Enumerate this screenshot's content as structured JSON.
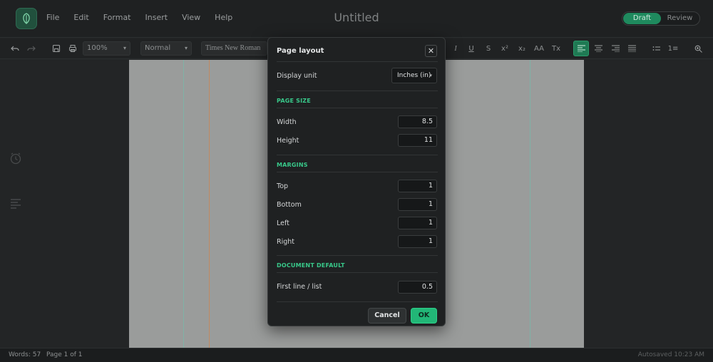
{
  "app": {
    "title": "Untitled",
    "menu": [
      "File",
      "Edit",
      "Format",
      "Insert",
      "View",
      "Help"
    ],
    "mode": {
      "options": [
        "Draft",
        "Review"
      ],
      "active": "Draft"
    }
  },
  "toolbar": {
    "zoom": "100%",
    "style": "Normal",
    "font": "Times New Roman",
    "text_buttons": {
      "italic": "I",
      "underline": "U",
      "strikethrough": "S",
      "superscript": "x²",
      "subscript": "x₂",
      "change_case": "AA",
      "clear_format": "Tx",
      "numbered_list": "1≡"
    },
    "active_align": "align-left",
    "accent_color": "#1f7a54"
  },
  "dialog": {
    "title": "Page layout",
    "close_glyph": "✕",
    "display_unit_label": "Display unit",
    "display_unit_value": "Inches (in)",
    "sections": {
      "page_size": "PAGE SIZE",
      "margins": "MARGINS",
      "document_default": "DOCUMENT DEFAULT"
    },
    "fields": {
      "width": {
        "label": "Width",
        "value": "8.5"
      },
      "height": {
        "label": "Height",
        "value": "11"
      },
      "top": {
        "label": "Top",
        "value": "1"
      },
      "bottom": {
        "label": "Bottom",
        "value": "1"
      },
      "left": {
        "label": "Left",
        "value": "1"
      },
      "right": {
        "label": "Right",
        "value": "1"
      },
      "first_line": {
        "label": "First line / list",
        "value": "0.5"
      }
    },
    "cancel_label": "Cancel",
    "ok_label": "OK",
    "accent_color": "#22b777"
  },
  "status": {
    "words": "Words: 57",
    "page": "Page 1 of 1",
    "autosave": "Autosaved 10:23 AM"
  }
}
